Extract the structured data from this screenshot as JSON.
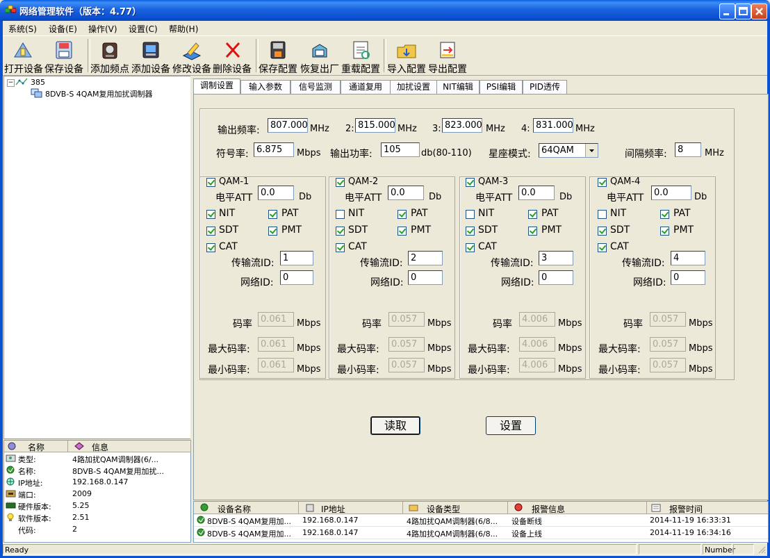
{
  "window": {
    "title": "网络管理软件（版本：4.77）"
  },
  "menu": [
    "系统(S)",
    "设备(E)",
    "操作(V)",
    "设置(C)",
    "帮助(H)"
  ],
  "toolbar": [
    {
      "label": "打开设备",
      "icon": "open-device-icon"
    },
    {
      "label": "保存设备",
      "icon": "save-device-icon"
    },
    {
      "label": "添加频点",
      "icon": "add-frequency-icon"
    },
    {
      "label": "添加设备",
      "icon": "add-device-icon"
    },
    {
      "label": "修改设备",
      "icon": "edit-device-icon"
    },
    {
      "label": "删除设备",
      "icon": "delete-device-icon"
    },
    {
      "label": "保存配置",
      "icon": "save-config-icon"
    },
    {
      "label": "恢复出厂",
      "icon": "factory-reset-icon"
    },
    {
      "label": "重载配置",
      "icon": "reload-config-icon"
    },
    {
      "label": "导入配置",
      "icon": "import-config-icon"
    },
    {
      "label": "导出配置",
      "icon": "export-config-icon"
    }
  ],
  "tree": {
    "root": "385",
    "child": "8DVB-S 4QAM复用加扰调制器"
  },
  "info": {
    "headers": [
      "名称",
      "信息"
    ],
    "rows": [
      {
        "key": "类型:",
        "value": "4路加扰QAM调制器(6/..."
      },
      {
        "key": "名称:",
        "value": "8DVB-S 4QAM复用加扰..."
      },
      {
        "key": "IP地址:",
        "value": "192.168.0.147"
      },
      {
        "key": "端口:",
        "value": "2009"
      },
      {
        "key": "硬件版本:",
        "value": "5.25"
      },
      {
        "key": "软件版本:",
        "value": "2.51"
      },
      {
        "key": "代码:",
        "value": "2"
      }
    ]
  },
  "tabs": [
    "调制设置",
    "输入参数",
    "信号监测",
    "通道复用",
    "加扰设置",
    "NIT编辑",
    "PSI编辑",
    "PID透传"
  ],
  "modulation": {
    "freq_label": "输出频率:",
    "freq_values": [
      "807.000",
      "815.000",
      "823.000",
      "831.000"
    ],
    "freq_prefixes": [
      "",
      "2:",
      "3:",
      "4:"
    ],
    "freq_unit": "MHz",
    "symbol_label": "符号率:",
    "symbol_value": "6.875",
    "symbol_unit": "Mbps",
    "power_label": "输出功率:",
    "power_value": "105",
    "power_unit": "db(80-110)",
    "constellation_label": "星座模式:",
    "constellation_value": "64QAM",
    "spacing_label": "间隔频率:",
    "spacing_value": "8",
    "spacing_unit": "MHz"
  },
  "qam_labels": {
    "att": "电平ATT",
    "att_unit": "Db",
    "nit": "NIT",
    "pat": "PAT",
    "sdt": "SDT",
    "pmt": "PMT",
    "cat": "CAT",
    "tsid": "传输流ID:",
    "netid": "网络ID:",
    "rate": "码率",
    "max_rate": "最大码率:",
    "min_rate": "最小码率:",
    "rate_unit": "Mbps"
  },
  "qams": [
    {
      "name": "QAM-1",
      "enabled": true,
      "att": "0.0",
      "nit": true,
      "pat": true,
      "sdt": true,
      "pmt": true,
      "cat": true,
      "tsid": "1",
      "netid": "0",
      "rate": "0.061",
      "max_rate": "0.061",
      "min_rate": "0.061"
    },
    {
      "name": "QAM-2",
      "enabled": true,
      "att": "0.0",
      "nit": false,
      "pat": true,
      "sdt": true,
      "pmt": true,
      "cat": true,
      "tsid": "2",
      "netid": "0",
      "rate": "0.057",
      "max_rate": "0.057",
      "min_rate": "0.057"
    },
    {
      "name": "QAM-3",
      "enabled": true,
      "att": "0.0",
      "nit": false,
      "pat": true,
      "sdt": true,
      "pmt": true,
      "cat": true,
      "tsid": "3",
      "netid": "0",
      "rate": "4.006",
      "max_rate": "4.006",
      "min_rate": "4.006"
    },
    {
      "name": "QAM-4",
      "enabled": true,
      "att": "0.0",
      "nit": false,
      "pat": true,
      "sdt": true,
      "pmt": true,
      "cat": true,
      "tsid": "4",
      "netid": "0",
      "rate": "0.057",
      "max_rate": "0.057",
      "min_rate": "0.057"
    }
  ],
  "buttons": {
    "read": "读取",
    "set": "设置"
  },
  "alarms": {
    "headers": [
      "设备名称",
      "IP地址",
      "设备类型",
      "报警信息",
      "报警时间"
    ],
    "rows": [
      {
        "name": "8DVB-S 4QAM复用加...",
        "ip": "192.168.0.147",
        "type": "4路加扰QAM调制器(6/8...",
        "msg": "设备断线",
        "time": "2014-11-19 16:33:31"
      },
      {
        "name": "8DVB-S 4QAM复用加...",
        "ip": "192.168.0.147",
        "type": "4路加扰QAM调制器(6/8...",
        "msg": "设备上线",
        "time": "2014-11-19 16:34:16"
      }
    ]
  },
  "status": {
    "text": "Ready",
    "num": "Number"
  }
}
